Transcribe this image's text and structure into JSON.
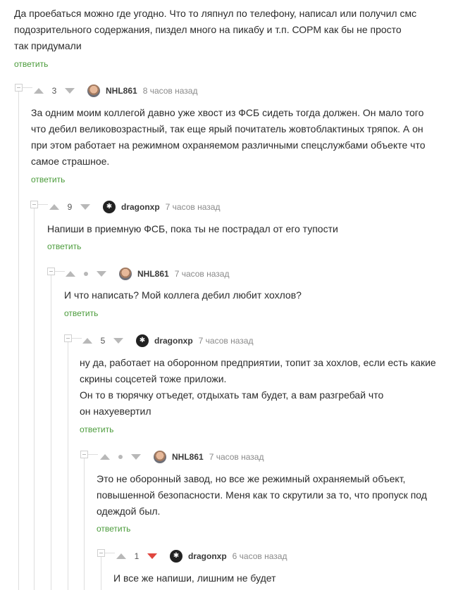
{
  "top_comment": {
    "lines": [
      "Да проебаться можно где угодно. Что то ляпнул по телефону, написал или получил смс",
      "подозрительного содержания, пиздел много на пикабу и т.п. СОРМ как бы не просто",
      "так придумали"
    ],
    "reply": "ответить"
  },
  "comments": [
    {
      "rating": "3",
      "author": "NHL861",
      "time": "8 часов назад",
      "lines": [
        "За одним моим коллегой давно уже хвост из ФСБ сидеть тогда должен. Он мало того",
        "что дебил великовозрастный, так еще ярый почитатель жовтоблактиных тряпок. А он",
        "при этом работает на режимном охраняемом различными спецслужбами объекте что",
        "самое страшное."
      ],
      "reply": "ответить"
    },
    {
      "rating": "9",
      "author": "dragonxp",
      "time": "7 часов назад",
      "lines": [
        "Напиши в приемную ФСБ, пока ты не пострадал от его тупости"
      ],
      "reply": "ответить"
    },
    {
      "rating": "",
      "author": "NHL861",
      "time": "7 часов назад",
      "lines": [
        "И что написать? Мой коллега дебил любит хохлов?"
      ],
      "reply": "ответить"
    },
    {
      "rating": "5",
      "author": "dragonxp",
      "time": "7 часов назад",
      "lines": [
        "ну да, работает на оборонном предприятии, топит за хохлов, если есть какие",
        "скрины соцсетей тоже приложи.",
        "Он то в тюрячку отъедет, отдыхать там будет, а вам разгребай что",
        "он нахуевертил"
      ],
      "reply": "ответить"
    },
    {
      "rating": "",
      "author": "NHL861",
      "time": "7 часов назад",
      "lines": [
        "Это не оборонный завод, но все же режимный охраняемый объект,",
        "повышенной безопасности. Меня как то скрутили за то, что пропуск под",
        "одеждой был."
      ],
      "reply": "ответить"
    },
    {
      "rating": "1",
      "author": "dragonxp",
      "time": "6 часов назад",
      "lines": [
        "И все же напиши, лишним не будет"
      ],
      "reply": ""
    }
  ],
  "colors": {
    "reply_link": "#4a9b3a",
    "downvote_active": "#e0463f",
    "vote_arrow": "#b8b8b8",
    "thread_line": "#dedede"
  },
  "icons": {
    "upvote": "arrow-up-icon",
    "downvote": "arrow-down-icon",
    "collapse": "collapse-minus-icon",
    "dragonxp_avatar": "dragon-logo-icon"
  }
}
